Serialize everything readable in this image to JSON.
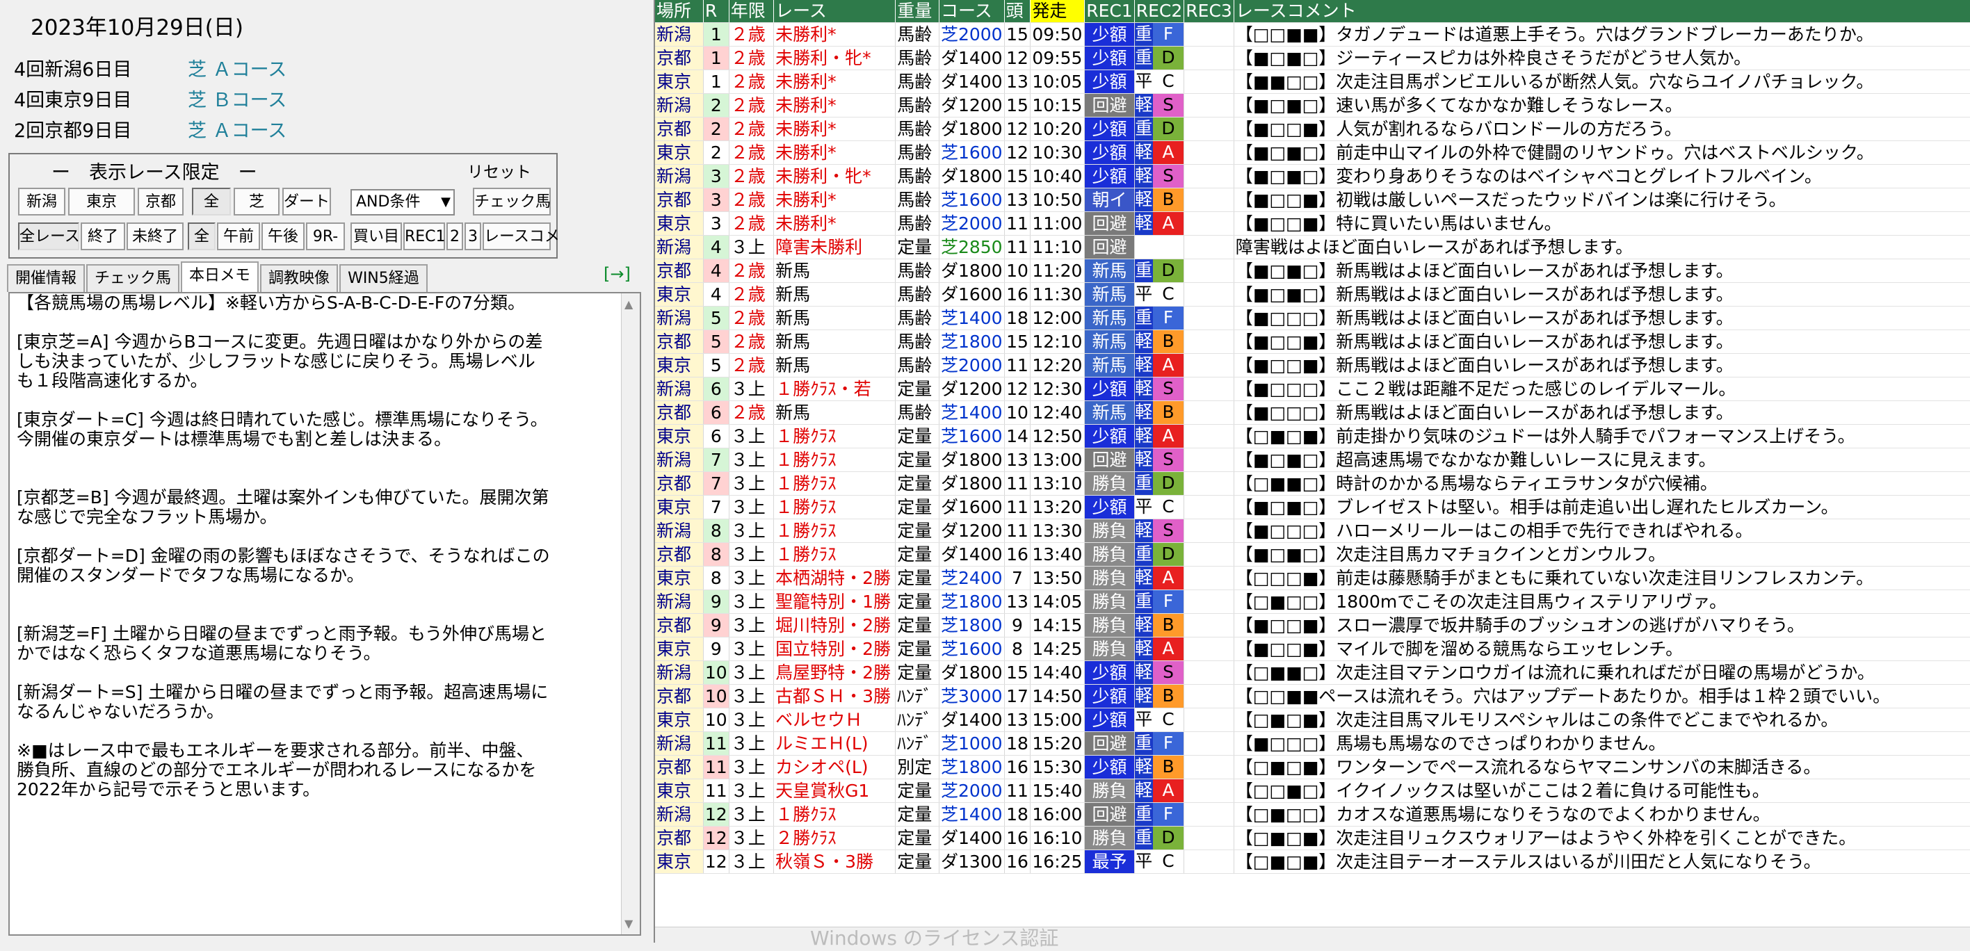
{
  "date": "2023年10月29日(日)",
  "meetings": [
    {
      "name": "4回新潟6日目",
      "course": "芝 Ａコース"
    },
    {
      "name": "4回東京9日目",
      "course": "芝 Ｂコース"
    },
    {
      "name": "2回京都9日目",
      "course": "芝 Ａコース"
    }
  ],
  "filter": {
    "title": "ー　表示レース限定　ー",
    "reset": "リセット",
    "venues": [
      "新潟",
      "東京",
      "京都"
    ],
    "surfaces": [
      "全",
      "芝",
      "ダート"
    ],
    "condition_select": "AND条件",
    "check_horse": "チェック馬",
    "race_scope": [
      "全レース",
      "終了",
      "未終了"
    ],
    "time_scope": [
      "全",
      "午前",
      "午後",
      "9R-"
    ],
    "buy_target": "買い目",
    "recommend": [
      "REC1",
      "2",
      "3"
    ],
    "race_comment": "レースコメ"
  },
  "tabs": [
    "開催情報",
    "チェック馬",
    "本日メモ",
    "調教映像",
    "WIN5経過"
  ],
  "tab_arrow": "[→]",
  "memo": [
    "【各競馬場の馬場レベル】※軽い方からS-A-B-C-D-E-Fの7分類。",
    "",
    "[東京芝=A] 今週からBコースに変更。先週日曜はかなり外からの差",
    "しも決まっていたが、少しフラットな感じに戻りそう。馬場レベル",
    "も１段階高速化するか。",
    "",
    "[東京ダート=C] 今週は終日晴れていた感じ。標準馬場になりそう。",
    "今開催の東京ダートは標準馬場でも割と差しは決まる。",
    "",
    "",
    "[京都芝=B] 今週が最終週。土曜は案外インも伸びていた。展開次第",
    "な感じで完全なフラット馬場か。",
    "",
    "[京都ダート=D] 金曜の雨の影響もほぼなさそうで、そうなればこの",
    "開催のスタンダードでタフな馬場になるか。",
    "",
    "",
    "[新潟芝=F] 土曜から日曜の昼までずっと雨予報。もう外伸び馬場と",
    "かではなく恐らくタフな道悪馬場になりそう。",
    "",
    "[新潟ダート=S] 土曜から日曜の昼までずっと雨予報。超高速馬場に",
    "なるんじゃないだろうか。",
    "",
    "※■はレース中で最もエネルギーを要求される部分。前半、中盤、",
    "勝負所、直線のどの部分でエネルギーが問われるレースになるかを",
    "2022年から記号で示そうと思います。"
  ],
  "table": {
    "headers": [
      "場所",
      "R",
      "年限",
      "レース",
      "重量",
      "コース",
      "頭",
      "発走",
      "REC1",
      "REC2",
      "REC3",
      "レースコメント"
    ],
    "rows": [
      {
        "venue": "新潟",
        "r": "1",
        "age": "２歳",
        "race": "未勝利*",
        "wt": "馬齢",
        "course": "芝2000",
        "n": "15",
        "time": "09:50",
        "rec1": "少額",
        "rec2l": "重",
        "rec2": "F",
        "comment": "【□□■■】タガノデュードは道悪上手そう。穴はグランドブレーカーあたりか。"
      },
      {
        "venue": "京都",
        "r": "1",
        "age": "２歳",
        "race": "未勝利・牝*",
        "wt": "馬齢",
        "course": "ダ1400",
        "n": "12",
        "time": "09:55",
        "rec1": "少額",
        "rec2l": "重",
        "rec2": "D",
        "comment": "【■□■□】ジーティースピカは外枠良さそうだがどうせ人気か。"
      },
      {
        "venue": "東京",
        "r": "1",
        "age": "２歳",
        "race": "未勝利*",
        "wt": "馬齢",
        "course": "ダ1400",
        "n": "13",
        "time": "10:05",
        "rec1": "少額",
        "rec2l": "平",
        "rec2": "C",
        "comment": "【■■□□】次走注目馬ポンビエルいるが断然人気。穴ならユイノパチョレック。"
      },
      {
        "venue": "新潟",
        "r": "2",
        "age": "２歳",
        "race": "未勝利*",
        "wt": "馬齢",
        "course": "ダ1200",
        "n": "15",
        "time": "10:15",
        "rec1": "回避",
        "rec2l": "軽",
        "rec2": "S",
        "comment": "【■□■□】速い馬が多くてなかなか難しそうなレース。"
      },
      {
        "venue": "京都",
        "r": "2",
        "age": "２歳",
        "race": "未勝利*",
        "wt": "馬齢",
        "course": "ダ1800",
        "n": "12",
        "time": "10:20",
        "rec1": "少額",
        "rec2l": "重",
        "rec2": "D",
        "comment": "【■□□■】人気が割れるならバロンドールの方だろう。"
      },
      {
        "venue": "東京",
        "r": "2",
        "age": "２歳",
        "race": "未勝利*",
        "wt": "馬齢",
        "course": "芝1600",
        "n": "12",
        "time": "10:30",
        "rec1": "少額",
        "rec2l": "軽",
        "rec2": "A",
        "comment": "【■□■□】前走中山マイルの外枠で健闘のリヤンドゥ。穴はベストベルシック。"
      },
      {
        "venue": "新潟",
        "r": "3",
        "age": "２歳",
        "race": "未勝利・牝*",
        "wt": "馬齢",
        "course": "ダ1800",
        "n": "15",
        "time": "10:40",
        "rec1": "少額",
        "rec2l": "軽",
        "rec2": "S",
        "comment": "【■□■□】変わり身ありそうなのはベイシャベコとグレイトフルベイン。"
      },
      {
        "venue": "京都",
        "r": "3",
        "age": "２歳",
        "race": "未勝利*",
        "wt": "馬齢",
        "course": "芝1600",
        "n": "13",
        "time": "10:50",
        "rec1": "朝イ",
        "rec2l": "軽",
        "rec2": "B",
        "comment": "【■□□■】初戦は厳しいペースだったウッドバインは楽に行けそう。"
      },
      {
        "venue": "東京",
        "r": "3",
        "age": "２歳",
        "race": "未勝利*",
        "wt": "馬齢",
        "course": "芝2000",
        "n": "11",
        "time": "11:00",
        "rec1": "回避",
        "rec2l": "軽",
        "rec2": "A",
        "comment": "【■□□■】特に買いたい馬はいません。"
      },
      {
        "venue": "新潟",
        "r": "4",
        "age": "３上",
        "race": "障害未勝利",
        "wt": "定量",
        "course": "芝2850",
        "n": "11",
        "time": "11:10",
        "rec1": "回避",
        "rec2l": "",
        "rec2": "",
        "comment": "障害戦はよほど面白いレースがあれば予想します。"
      },
      {
        "venue": "京都",
        "r": "4",
        "age": "２歳",
        "race": "新馬",
        "wt": "馬齢",
        "course": "ダ1800",
        "n": "10",
        "time": "11:20",
        "rec1": "新馬",
        "rec2l": "重",
        "rec2": "D",
        "comment": "【■□■□】新馬戦はよほど面白いレースがあれば予想します。"
      },
      {
        "venue": "東京",
        "r": "4",
        "age": "２歳",
        "race": "新馬",
        "wt": "馬齢",
        "course": "ダ1600",
        "n": "16",
        "time": "11:30",
        "rec1": "新馬",
        "rec2l": "平",
        "rec2": "C",
        "comment": "【■□■□】新馬戦はよほど面白いレースがあれば予想します。"
      },
      {
        "venue": "新潟",
        "r": "5",
        "age": "２歳",
        "race": "新馬",
        "wt": "馬齢",
        "course": "芝1400",
        "n": "18",
        "time": "12:00",
        "rec1": "新馬",
        "rec2l": "重",
        "rec2": "F",
        "comment": "【■□□□】新馬戦はよほど面白いレースがあれば予想します。"
      },
      {
        "venue": "京都",
        "r": "5",
        "age": "２歳",
        "race": "新馬",
        "wt": "馬齢",
        "course": "芝1800",
        "n": "15",
        "time": "12:10",
        "rec1": "新馬",
        "rec2l": "軽",
        "rec2": "B",
        "comment": "【■□□■】新馬戦はよほど面白いレースがあれば予想します。"
      },
      {
        "venue": "東京",
        "r": "5",
        "age": "２歳",
        "race": "新馬",
        "wt": "馬齢",
        "course": "芝2000",
        "n": "11",
        "time": "12:20",
        "rec1": "新馬",
        "rec2l": "軽",
        "rec2": "A",
        "comment": "【■□□■】新馬戦はよほど面白いレースがあれば予想します。"
      },
      {
        "venue": "新潟",
        "r": "6",
        "age": "３上",
        "race": "１勝ｸﾗｽ・若",
        "wt": "定量",
        "course": "ダ1200",
        "n": "12",
        "time": "12:30",
        "rec1": "少額",
        "rec2l": "軽",
        "rec2": "S",
        "comment": "【■□□□】ここ２戦は距離不足だった感じのレイデルマール。"
      },
      {
        "venue": "京都",
        "r": "6",
        "age": "２歳",
        "race": "新馬",
        "wt": "馬齢",
        "course": "芝1400",
        "n": "10",
        "time": "12:40",
        "rec1": "新馬",
        "rec2l": "軽",
        "rec2": "B",
        "comment": "【■□□□】新馬戦はよほど面白いレースがあれば予想します。"
      },
      {
        "venue": "東京",
        "r": "6",
        "age": "３上",
        "race": "１勝ｸﾗｽ",
        "wt": "定量",
        "course": "芝1600",
        "n": "14",
        "time": "12:50",
        "rec1": "少額",
        "rec2l": "軽",
        "rec2": "A",
        "comment": "【□■□■】前走掛かり気味のジュドーは外人騎手でパフォーマンス上げそう。"
      },
      {
        "venue": "新潟",
        "r": "7",
        "age": "３上",
        "race": "１勝ｸﾗｽ",
        "wt": "定量",
        "course": "ダ1800",
        "n": "13",
        "time": "13:00",
        "rec1": "回避",
        "rec2l": "軽",
        "rec2": "S",
        "comment": "【■□■□】超高速馬場でなかなか難しいレースに見えます。"
      },
      {
        "venue": "京都",
        "r": "7",
        "age": "３上",
        "race": "１勝ｸﾗｽ",
        "wt": "定量",
        "course": "ダ1800",
        "n": "11",
        "time": "13:10",
        "rec1": "勝負",
        "rec2l": "重",
        "rec2": "D",
        "comment": "【□■■□】時計のかかる馬場ならティエラサンタが穴候補。"
      },
      {
        "venue": "東京",
        "r": "7",
        "age": "３上",
        "race": "１勝ｸﾗｽ",
        "wt": "定量",
        "course": "ダ1600",
        "n": "11",
        "time": "13:20",
        "rec1": "少額",
        "rec2l": "平",
        "rec2": "C",
        "comment": "【■□■□】ブレイゼストは堅い。相手は前走追い出し遅れたヒルズカーン。"
      },
      {
        "venue": "新潟",
        "r": "8",
        "age": "３上",
        "race": "１勝ｸﾗｽ",
        "wt": "定量",
        "course": "ダ1200",
        "n": "11",
        "time": "13:30",
        "rec1": "勝負",
        "rec2l": "軽",
        "rec2": "S",
        "comment": "【■□□□】ハローメリールーはこの相手で先行できればやれる。"
      },
      {
        "venue": "京都",
        "r": "8",
        "age": "３上",
        "race": "１勝ｸﾗｽ",
        "wt": "定量",
        "course": "ダ1400",
        "n": "16",
        "time": "13:40",
        "rec1": "勝負",
        "rec2l": "重",
        "rec2": "D",
        "comment": "【■□■□】次走注目馬カマチョクインとガンウルフ。"
      },
      {
        "venue": "東京",
        "r": "8",
        "age": "３上",
        "race": "本栖湖特・2勝",
        "wt": "定量",
        "course": "芝2400",
        "n": "7",
        "time": "13:50",
        "rec1": "勝負",
        "rec2l": "軽",
        "rec2": "A",
        "comment": "【□□□■】前走は藤懸騎手がまともに乗れていない次走注目リンフレスカンテ。"
      },
      {
        "venue": "新潟",
        "r": "9",
        "age": "３上",
        "race": "聖籠特別・1勝",
        "wt": "定量",
        "course": "芝1800",
        "n": "13",
        "time": "14:05",
        "rec1": "勝負",
        "rec2l": "重",
        "rec2": "F",
        "comment": "【□■□□】1800mでこその次走注目馬ウィステリアリヴァ。"
      },
      {
        "venue": "京都",
        "r": "9",
        "age": "３上",
        "race": "堀川特別・2勝",
        "wt": "定量",
        "course": "芝1800",
        "n": "9",
        "time": "14:15",
        "rec1": "勝負",
        "rec2l": "軽",
        "rec2": "B",
        "comment": "【■□□■】スロー濃厚で坂井騎手のブッシュオンの逃げがハマりそう。"
      },
      {
        "venue": "東京",
        "r": "9",
        "age": "３上",
        "race": "国立特別・2勝",
        "wt": "定量",
        "course": "芝1600",
        "n": "8",
        "time": "14:25",
        "rec1": "勝負",
        "rec2l": "軽",
        "rec2": "A",
        "comment": "【■□□■】マイルで脚を溜める競馬ならエッセレンチ。"
      },
      {
        "venue": "新潟",
        "r": "10",
        "age": "３上",
        "race": "鳥屋野特・2勝",
        "wt": "定量",
        "course": "ダ1800",
        "n": "15",
        "time": "14:40",
        "rec1": "少額",
        "rec2l": "軽",
        "rec2": "S",
        "comment": "【□■■□】次走注目マテンロウガイは流れに乗れればだが日曜の馬場がどうか。"
      },
      {
        "venue": "京都",
        "r": "10",
        "age": "３上",
        "race": "古都ＳＨ・3勝",
        "wt": "ﾊﾝﾃﾞ",
        "course": "芝3000",
        "n": "17",
        "time": "14:50",
        "rec1": "少額",
        "rec2l": "軽",
        "rec2": "B",
        "comment": "【□□■■ペースは流れそう。穴はアップデートあたりか。相手は１枠２頭でいい。"
      },
      {
        "venue": "東京",
        "r": "10",
        "age": "３上",
        "race": "ベルセウＨ",
        "wt": "ﾊﾝﾃﾞ",
        "course": "ダ1400",
        "n": "13",
        "time": "15:00",
        "rec1": "少額",
        "rec2l": "平",
        "rec2": "C",
        "comment": "【□■□■】次走注目馬マルモリスペシャルはこの条件でどこまでやれるか。"
      },
      {
        "venue": "新潟",
        "r": "11",
        "age": "３上",
        "race": "ルミエＨ(L)",
        "wt": "ﾊﾝﾃﾞ",
        "course": "芝1000",
        "n": "18",
        "time": "15:20",
        "rec1": "回避",
        "rec2l": "重",
        "rec2": "F",
        "comment": "【■□□□】馬場も馬場なのでさっぱりわかりません。"
      },
      {
        "venue": "京都",
        "r": "11",
        "age": "３上",
        "race": "カシオペ(L)",
        "wt": "別定",
        "course": "芝1800",
        "n": "16",
        "time": "15:30",
        "rec1": "少額",
        "rec2l": "軽",
        "rec2": "B",
        "comment": "【□■□■】ワンターンでペース流れるならヤマニンサンバの末脚活きる。"
      },
      {
        "venue": "東京",
        "r": "11",
        "age": "３上",
        "race": "天皇賞秋G1",
        "wt": "定量",
        "course": "芝2000",
        "n": "11",
        "time": "15:40",
        "rec1": "勝負",
        "rec2l": "軽",
        "rec2": "A",
        "comment": "【□□■□】イクイノックスは堅いがここは２着に負ける可能性も。"
      },
      {
        "venue": "新潟",
        "r": "12",
        "age": "３上",
        "race": "１勝ｸﾗｽ",
        "wt": "定量",
        "course": "芝1400",
        "n": "18",
        "time": "16:00",
        "rec1": "回避",
        "rec2l": "重",
        "rec2": "F",
        "comment": "【□■□□】カオスな道悪馬場になりそうなのでよくわかりません。"
      },
      {
        "venue": "京都",
        "r": "12",
        "age": "３上",
        "race": "２勝ｸﾗｽ",
        "wt": "定量",
        "course": "ダ1400",
        "n": "16",
        "time": "16:10",
        "rec1": "勝負",
        "rec2l": "重",
        "rec2": "D",
        "comment": "【□■□■】次走注目リュクスウォリアーはようやく外枠を引くことができた。"
      },
      {
        "venue": "東京",
        "r": "12",
        "age": "３上",
        "race": "秋嶺Ｓ・3勝",
        "wt": "定量",
        "course": "ダ1300",
        "n": "16",
        "time": "16:25",
        "rec1": "最予",
        "rec2l": "平",
        "rec2": "C",
        "comment": "【□■□■】次走注目テーオーステルスはいるが川田だと人気になりそう。"
      }
    ]
  },
  "watermark": "Windows のライセンス認証"
}
